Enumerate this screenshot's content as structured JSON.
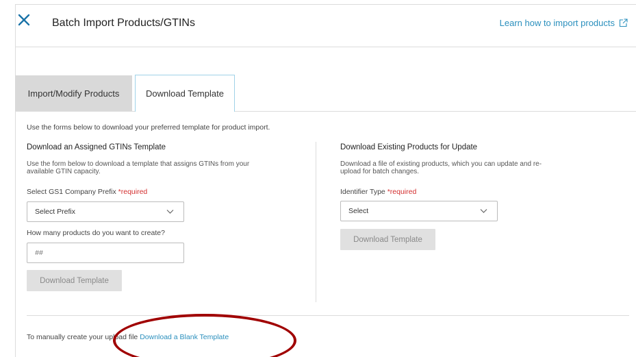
{
  "header": {
    "title": "Batch Import Products/GTINs",
    "learn_link": "Learn how to import products"
  },
  "tabs": [
    {
      "label": "Import/Modify Products",
      "active": false
    },
    {
      "label": "Download Template",
      "active": true
    }
  ],
  "intro": "Use the forms below to download your preferred template for product import.",
  "assigned": {
    "title": "Download an Assigned GTINs Template",
    "description_line1": "Use the form below to download a template that assigns GTINs from your",
    "description_line2": "available GTIN capacity.",
    "prefix_label": "Select GS1 Company Prefix",
    "required_text": "*required",
    "prefix_select_value": "Select Prefix",
    "quantity_label": "How many products do you want to create?",
    "quantity_placeholder": "##",
    "button_label": "Download Template"
  },
  "existing": {
    "title": "Download Existing Products for Update",
    "description_line1": "Download a file of existing products, which you can update and re-",
    "description_line2": "upload for batch changes.",
    "identifier_label": "Identifier Type",
    "required_text": "*required",
    "identifier_select_value": "Select",
    "button_label": "Download Template"
  },
  "footer": {
    "text": "To manually create your upload file",
    "link": "Download a Blank Template"
  },
  "colors": {
    "link": "#2a8fbd",
    "required": "#d32f2f",
    "annotation": "#a00000"
  }
}
